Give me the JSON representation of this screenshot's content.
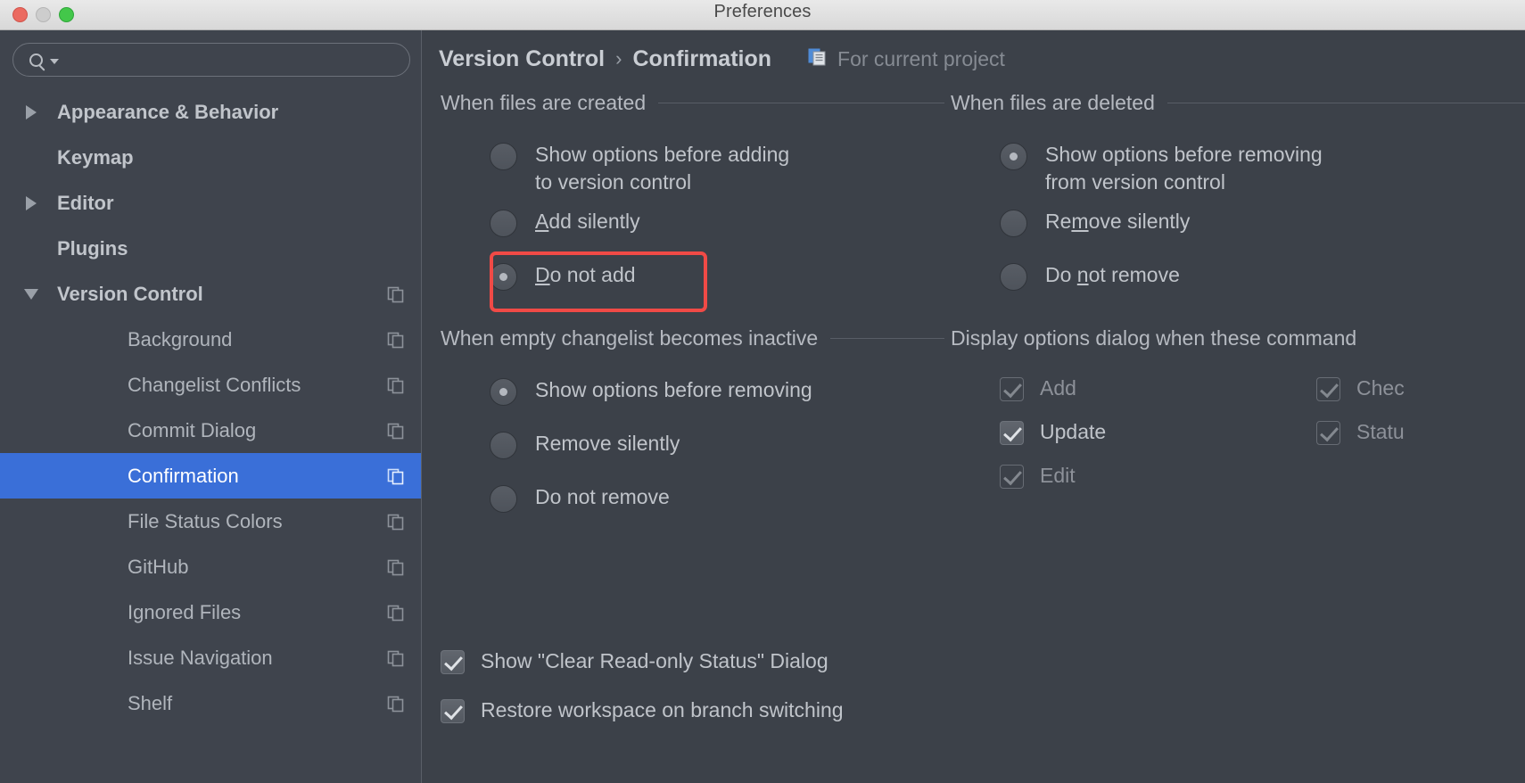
{
  "window": {
    "title": "Preferences",
    "traffic_lights": [
      "close-button",
      "minimize-button",
      "zoom-button"
    ]
  },
  "search": {
    "value": "",
    "placeholder": "",
    "icon": "search-icon",
    "dropdown_icon": "caret-down-icon"
  },
  "sidebar": {
    "items": [
      {
        "label": "Appearance & Behavior",
        "level": "top",
        "twisty": "right",
        "badge": false,
        "selected": false
      },
      {
        "label": "Keymap",
        "level": "top",
        "twisty": "none",
        "badge": false,
        "selected": false
      },
      {
        "label": "Editor",
        "level": "top",
        "twisty": "right",
        "badge": false,
        "selected": false
      },
      {
        "label": "Plugins",
        "level": "top",
        "twisty": "none",
        "badge": false,
        "selected": false
      },
      {
        "label": "Version Control",
        "level": "top",
        "twisty": "down",
        "badge": true,
        "selected": false
      },
      {
        "label": "Background",
        "level": "child",
        "twisty": "none",
        "badge": true,
        "selected": false
      },
      {
        "label": "Changelist Conflicts",
        "level": "child",
        "twisty": "none",
        "badge": true,
        "selected": false
      },
      {
        "label": "Commit Dialog",
        "level": "child",
        "twisty": "none",
        "badge": true,
        "selected": false
      },
      {
        "label": "Confirmation",
        "level": "child",
        "twisty": "none",
        "badge": true,
        "selected": true
      },
      {
        "label": "File Status Colors",
        "level": "child",
        "twisty": "none",
        "badge": true,
        "selected": false
      },
      {
        "label": "GitHub",
        "level": "child",
        "twisty": "none",
        "badge": true,
        "selected": false
      },
      {
        "label": "Ignored Files",
        "level": "child",
        "twisty": "none",
        "badge": true,
        "selected": false
      },
      {
        "label": "Issue Navigation",
        "level": "child",
        "twisty": "none",
        "badge": true,
        "selected": false
      },
      {
        "label": "Shelf",
        "level": "child",
        "twisty": "none",
        "badge": true,
        "selected": false
      }
    ]
  },
  "breadcrumb": {
    "parent": "Version Control",
    "separator": "›",
    "current": "Confirmation",
    "scope_label": "For current project",
    "scope_icon": "project-scope-icon"
  },
  "groups": {
    "files_created": {
      "title": "When files are created",
      "options": [
        {
          "label": "Show options before adding\nto version control",
          "checked": false,
          "mnemonic": ""
        },
        {
          "label": "Add silently",
          "checked": false,
          "mnemonic": "A"
        },
        {
          "label": "Do not add",
          "checked": true,
          "mnemonic": "D"
        }
      ]
    },
    "files_deleted": {
      "title": "When files are deleted",
      "options": [
        {
          "label": "Show options before removing\nfrom version control",
          "checked": true,
          "mnemonic": ""
        },
        {
          "label": "Remove silently",
          "checked": false,
          "mnemonic": "m"
        },
        {
          "label": "Do not remove",
          "checked": false,
          "mnemonic": "n"
        }
      ]
    },
    "empty_changelist": {
      "title": "When empty changelist becomes inactive",
      "options": [
        {
          "label": "Show options before removing",
          "checked": true
        },
        {
          "label": "Remove silently",
          "checked": false
        },
        {
          "label": "Do not remove",
          "checked": false
        }
      ]
    },
    "display_options": {
      "title": "Display options dialog when these command",
      "commands_col1": [
        {
          "label": "Add",
          "checked": true,
          "disabled": true
        },
        {
          "label": "Update",
          "checked": true,
          "disabled": false
        },
        {
          "label": "Edit",
          "checked": true,
          "disabled": true
        }
      ],
      "commands_col2": [
        {
          "label": "Chec",
          "checked": true,
          "disabled": true
        },
        {
          "label": "Statu",
          "checked": true,
          "disabled": true
        }
      ]
    }
  },
  "bottom_checks": [
    {
      "label": "Show \"Clear Read-only Status\" Dialog",
      "checked": true,
      "disabled": false
    },
    {
      "label": "Restore workspace on branch switching",
      "checked": true,
      "disabled": false
    }
  ],
  "colors": {
    "selection_blue": "#3a6fd8",
    "highlight_red": "#f04a46",
    "panel_bg": "#3c4149",
    "sidebar_bg": "#3f444d",
    "titlebar_bg": "#e3e3e3"
  }
}
